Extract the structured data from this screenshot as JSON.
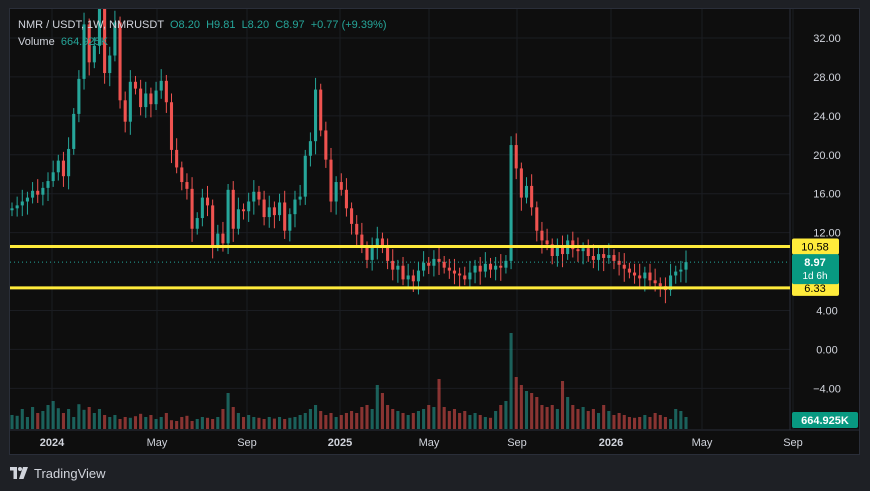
{
  "legend": {
    "symbol": "NMR / USDT, 1W, NMRUSDT",
    "open": "O8.20",
    "high": "H9.81",
    "low": "L8.20",
    "close": "C8.97",
    "change": "+0.77 (+9.39%)",
    "volume_label": "Volume",
    "volume_value": "664.925K"
  },
  "branding": {
    "name": "TradingView"
  },
  "colors": {
    "up": "#26a69a",
    "down": "#ef5350",
    "hline": "#ffeb3b",
    "bg": "#0e0e0e",
    "grid": "#1b1d22"
  },
  "chart_data": {
    "type": "candlestick",
    "title": "NMR / USDT, 1W, NMRUSDT",
    "y_ticks": [
      "32.00",
      "28.00",
      "24.00",
      "20.00",
      "16.00",
      "12.00",
      "4.00",
      "0.00",
      "−4.00"
    ],
    "ylim": [
      -8,
      35
    ],
    "x_ticks": [
      "2024",
      "May",
      "Sep",
      "2025",
      "May",
      "Sep",
      "2026",
      "May",
      "Sep"
    ],
    "horizontal_lines": [
      {
        "label": "10.58",
        "value": 10.58
      },
      {
        "label": "6.33",
        "value": 6.33
      }
    ],
    "last_price": {
      "label": "8.97",
      "value": 8.97,
      "countdown": "1d 6h"
    },
    "volume_label": "664.925K",
    "candles_close": [
      14.5,
      14.8,
      15.2,
      15.6,
      16.3,
      15.9,
      16.6,
      17.3,
      18.2,
      19.4,
      17.8,
      20.6,
      24.2,
      27.8,
      33.4,
      29.5,
      31.2,
      35.0,
      28.4,
      30.2,
      33.6,
      25.6,
      23.4,
      27.5,
      26.8,
      24.9,
      26.3,
      25.2,
      26.6,
      27.6,
      25.4,
      20.5,
      18.7,
      17.2,
      16.5,
      12.4,
      13.5,
      15.6,
      14.8,
      10.7,
      11.9,
      10.9,
      16.4,
      12.4,
      14.4,
      14.2,
      15.2,
      16.2,
      15.4,
      13.6,
      14.6,
      13.8,
      15.1,
      12.2,
      13.9,
      15.4,
      15.7,
      19.9,
      21.4,
      26.7,
      22.5,
      19.5,
      15.2,
      17.2,
      16.4,
      14.5,
      12.9,
      11.8,
      10.5,
      9.2,
      10.6,
      11.4,
      10.5,
      9.1,
      8.2,
      8.6,
      7.2,
      7.6,
      7.0,
      8.1,
      8.9,
      8.6,
      9.3,
      9.0,
      8.4,
      8.1,
      7.8,
      7.6,
      7.2,
      7.9,
      8.6,
      8.0,
      8.8,
      8.2,
      8.6,
      8.4,
      9.1,
      21.0,
      18.6,
      15.6,
      16.8,
      14.6,
      12.2,
      11.2,
      10.8,
      9.6,
      10.5,
      9.8,
      11.2,
      10.3,
      10.1,
      10.4,
      9.6,
      9.2,
      9.8,
      9.4,
      9.7,
      9.1,
      8.7,
      8.3,
      7.9,
      7.6,
      7.3,
      7.9,
      7.1,
      6.8,
      6.5,
      6.1,
      7.6,
      8.0,
      8.2,
      8.97
    ],
    "volume": [
      0.35,
      0.33,
      0.5,
      0.3,
      0.55,
      0.4,
      0.45,
      0.6,
      0.7,
      0.52,
      0.4,
      0.5,
      0.3,
      0.62,
      0.48,
      0.55,
      0.4,
      0.5,
      0.35,
      0.3,
      0.35,
      0.25,
      0.3,
      0.28,
      0.32,
      0.38,
      0.3,
      0.35,
      0.25,
      0.3,
      0.4,
      0.22,
      0.2,
      0.3,
      0.33,
      0.2,
      0.25,
      0.3,
      0.28,
      0.25,
      0.3,
      0.5,
      0.9,
      0.55,
      0.4,
      0.3,
      0.35,
      0.3,
      0.28,
      0.25,
      0.3,
      0.26,
      0.3,
      0.25,
      0.28,
      0.3,
      0.35,
      0.4,
      0.5,
      0.6,
      0.45,
      0.35,
      0.4,
      0.3,
      0.35,
      0.4,
      0.45,
      0.4,
      0.55,
      0.6,
      0.5,
      1.1,
      0.9,
      0.6,
      0.5,
      0.45,
      0.4,
      0.35,
      0.4,
      0.45,
      0.5,
      0.6,
      0.55,
      1.25,
      0.55,
      0.45,
      0.5,
      0.4,
      0.45,
      0.35,
      0.4,
      0.35,
      0.3,
      0.28,
      0.45,
      0.6,
      0.7,
      2.4,
      1.3,
      1.1,
      0.95,
      0.9,
      0.8,
      0.6,
      0.55,
      0.6,
      0.5,
      1.2,
      0.8,
      0.6,
      0.5,
      0.55,
      0.45,
      0.5,
      0.4,
      0.6,
      0.45,
      0.35,
      0.4,
      0.35,
      0.3,
      0.28,
      0.3,
      0.35,
      0.3,
      0.4,
      0.35,
      0.3,
      0.25,
      0.5,
      0.45,
      0.3,
      0.25,
      0.2,
      0.2
    ]
  }
}
